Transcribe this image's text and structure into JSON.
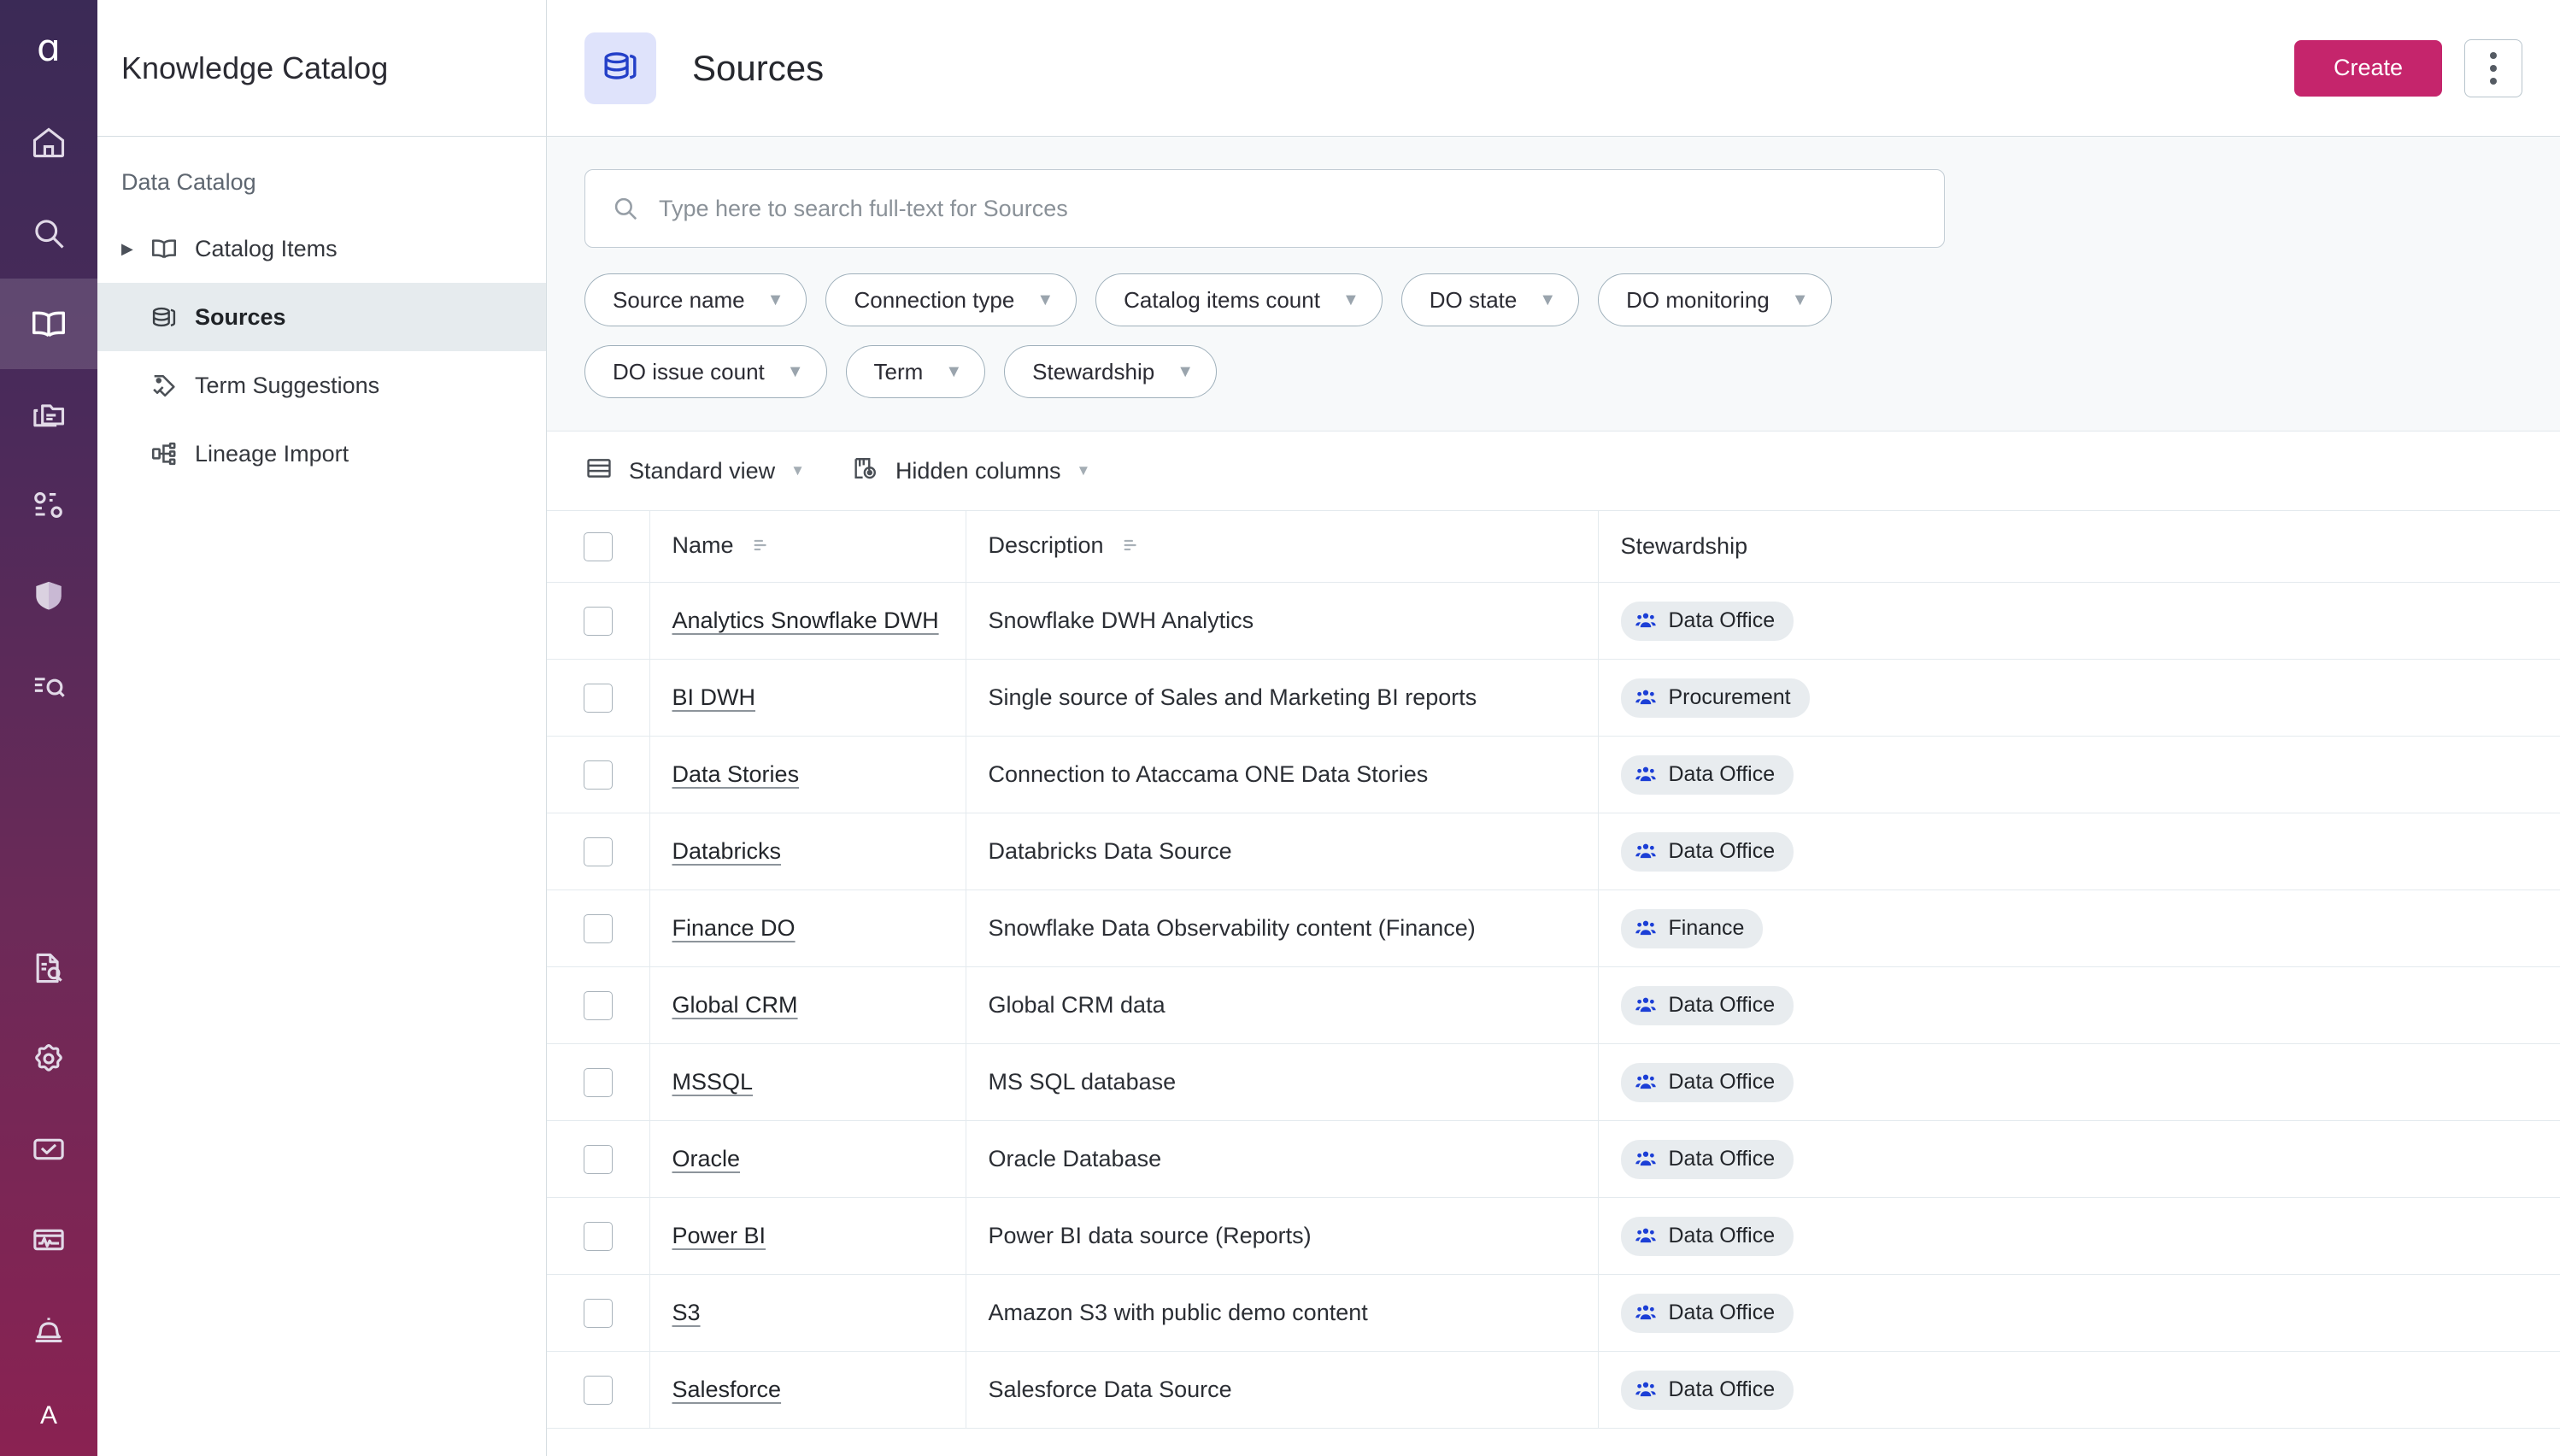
{
  "brand": {
    "logo_glyph": "ɑ",
    "accent_pink": "#c5256c",
    "rail_gradient_start": "#3b2a56",
    "rail_gradient_end": "#8a2252",
    "user_initial": "A"
  },
  "rail": {
    "items": [
      {
        "name": "home-icon",
        "label": "Home"
      },
      {
        "name": "search-icon",
        "label": "Search"
      },
      {
        "name": "book-icon",
        "label": "Knowledge Catalog",
        "active": true
      },
      {
        "name": "folders-icon",
        "label": "Data Collections"
      },
      {
        "name": "rules-icon",
        "label": "Data Quality"
      },
      {
        "name": "shield-icon",
        "label": "Governance"
      },
      {
        "name": "eq-search-icon",
        "label": "Data Observability"
      },
      {
        "name": "document-search-icon",
        "label": "Reports"
      },
      {
        "name": "gear-icon",
        "label": "Settings"
      },
      {
        "name": "checkbox-icon",
        "label": "Tasks"
      },
      {
        "name": "monitoring-icon",
        "label": "Monitoring"
      },
      {
        "name": "bell-icon",
        "label": "Notifications"
      }
    ]
  },
  "sidebar": {
    "title": "Knowledge Catalog",
    "section_label": "Data Catalog",
    "items": [
      {
        "label": "Catalog Items",
        "icon": "book-icon",
        "caret": true,
        "active": false
      },
      {
        "label": "Sources",
        "icon": "database-stack-icon",
        "caret": false,
        "active": true
      },
      {
        "label": "Term Suggestions",
        "icon": "tag-check-icon",
        "caret": false,
        "active": false
      },
      {
        "label": "Lineage Import",
        "icon": "lineage-icon",
        "caret": false,
        "active": false
      }
    ]
  },
  "header": {
    "page_icon": "database-stack-icon",
    "title": "Sources",
    "create_label": "Create",
    "kebab_label": "More actions"
  },
  "search": {
    "placeholder": "Type here to search full-text for Sources",
    "value": "",
    "icon": "search-icon"
  },
  "filters": [
    {
      "label": "Source name"
    },
    {
      "label": "Connection type"
    },
    {
      "label": "Catalog items count"
    },
    {
      "label": "DO state"
    },
    {
      "label": "DO monitoring"
    },
    {
      "label": "DO issue count"
    },
    {
      "label": "Term"
    },
    {
      "label": "Stewardship"
    }
  ],
  "toolbar": {
    "view_label": "Standard view",
    "view_icon": "table-rows-icon",
    "hidden_columns_label": "Hidden columns",
    "hidden_columns_icon": "hidden-column-icon"
  },
  "table": {
    "columns": [
      {
        "key": "check",
        "label": "",
        "sortable": false
      },
      {
        "key": "name",
        "label": "Name",
        "sortable": true
      },
      {
        "key": "description",
        "label": "Description",
        "sortable": true
      },
      {
        "key": "stewardship",
        "label": "Stewardship",
        "sortable": false
      }
    ],
    "rows": [
      {
        "name": "Analytics Snowflake DWH",
        "description": "Snowflake DWH Analytics",
        "stewardship": "Data Office",
        "checked": false
      },
      {
        "name": "BI DWH",
        "description": "Single source of Sales and Marketing BI reports",
        "stewardship": "Procurement",
        "checked": false
      },
      {
        "name": "Data Stories",
        "description": "Connection to Ataccama ONE Data Stories",
        "stewardship": "Data Office",
        "checked": false
      },
      {
        "name": "Databricks",
        "description": "Databricks Data Source",
        "stewardship": "Data Office",
        "checked": false
      },
      {
        "name": "Finance DO",
        "description": "Snowflake Data Observability content (Finance)",
        "stewardship": "Finance",
        "checked": false
      },
      {
        "name": "Global CRM",
        "description": "Global CRM data",
        "stewardship": "Data Office",
        "checked": false
      },
      {
        "name": "MSSQL",
        "description": "MS SQL database",
        "stewardship": "Data Office",
        "checked": false
      },
      {
        "name": "Oracle",
        "description": "Oracle Database",
        "stewardship": "Data Office",
        "checked": false
      },
      {
        "name": "Power BI",
        "description": "Power BI data source (Reports)",
        "stewardship": "Data Office",
        "checked": false
      },
      {
        "name": "S3",
        "description": "Amazon S3 with public demo content",
        "stewardship": "Data Office",
        "checked": false
      },
      {
        "name": "Salesforce",
        "description": "Salesforce Data Source",
        "stewardship": "Data Office",
        "checked": false
      }
    ]
  }
}
